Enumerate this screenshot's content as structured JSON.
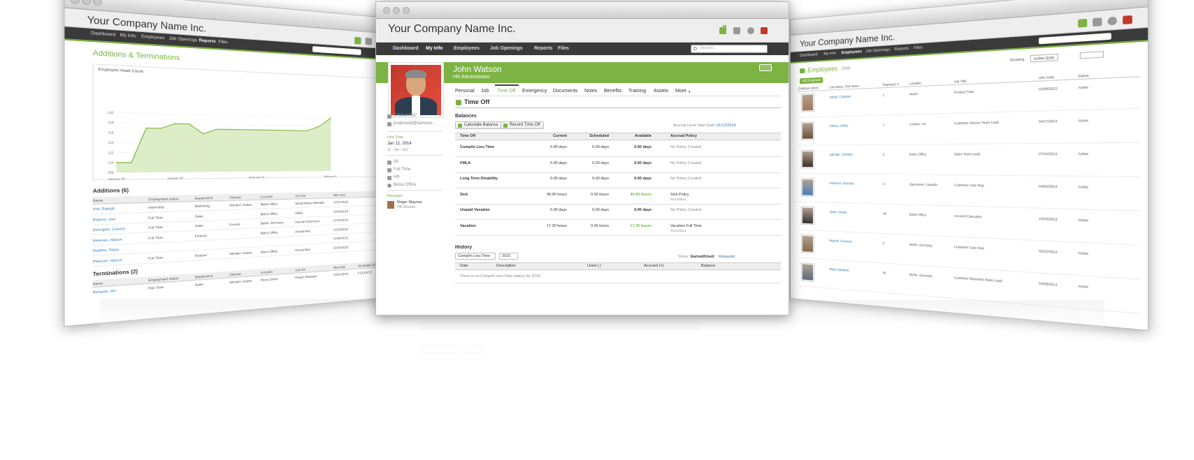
{
  "center": {
    "company": "Your Company Name Inc.",
    "search_placeholder": "Search...",
    "nav": [
      "Dashboard",
      "My Info",
      "Employees",
      "Job Openings",
      "Reports",
      "Files"
    ],
    "notify_count": "1",
    "profile": {
      "name": "John Watson",
      "title": "HR Administrator"
    },
    "tabs": [
      "Personal",
      "Job",
      "Time Off",
      "Emergency",
      "Documents",
      "Notes",
      "Benefits",
      "Training",
      "Assets",
      "More"
    ],
    "section_title": "Time Off",
    "balances_title": "Balances",
    "calc_button": "Calculate Balance",
    "record_button": "Record Time Off",
    "accrual_label": "Accrual Level Start Date:",
    "accrual_date": "01/12/2014",
    "table_headers": [
      "Time Off",
      "Current",
      "Scheduled",
      "Available",
      "Accrual Policy"
    ],
    "rows": [
      {
        "name": "Comp/In Lieu Time",
        "current": "0.00 days",
        "scheduled": "0.00 days",
        "available": "0.00 days",
        "policy": "No Policy Created",
        "policy_date": ""
      },
      {
        "name": "FMLA",
        "current": "0.00 days",
        "scheduled": "0.00 days",
        "available": "0.00 days",
        "policy": "No Policy Created",
        "policy_date": ""
      },
      {
        "name": "Long Term Disability",
        "current": "0.00 days",
        "scheduled": "0.00 days",
        "available": "0.00 days",
        "policy": "No Policy Created",
        "policy_date": ""
      },
      {
        "name": "Sick",
        "current": "40.00 hours",
        "scheduled": "0.00 hours",
        "available": "40.00 hours",
        "policy": "Sick Policy",
        "policy_date": "01/12/2014"
      },
      {
        "name": "Unpaid Vacation",
        "current": "0.00 days",
        "scheduled": "0.00 days",
        "available": "0.00 days",
        "policy": "No Policy Created",
        "policy_date": ""
      },
      {
        "name": "Vacation",
        "current": "17.20 hours",
        "scheduled": "0.00 hours",
        "available": "17.20 hours",
        "policy": "Vacation Full Time",
        "policy_date": "01/12/2014"
      }
    ],
    "history_title": "History",
    "history_type": "Comp/In Lieu Time",
    "history_year": "2015",
    "show_label": "Show:",
    "show_earned": "Earned/Used",
    "show_requests": "Requests",
    "history_headers": [
      "Date",
      "Description",
      "Used (-)",
      "Accrued (+)",
      "Balance"
    ],
    "history_empty": "There is no Comp/In Lieu Time history for 2015.",
    "sidebar": {
      "phone": "8768487687",
      "email": "pnahrwold@bamboo...",
      "hire_label": "Hire Date",
      "hire_date": "Jan 12, 2014",
      "hire_tenure": "1y - 1m - 11d",
      "emp_no": "59",
      "emp_type": "Full Time",
      "dept": "HR",
      "location": "Boise Office",
      "manager_label": "Manager",
      "manager_name": "Roger Maynes",
      "manager_title": "HR Director"
    }
  },
  "left": {
    "company": "Your Company Name Inc.",
    "nav": [
      "Dashboard",
      "My Info",
      "Employees",
      "Job Openings",
      "Reports",
      "Files"
    ],
    "page_title": "Additions & Terminations",
    "chart_title": "Employee Head Count",
    "additions_title": "Additions (6)",
    "add_headers": [
      "Name",
      "Employment status",
      "Department",
      "Division",
      "Location",
      "Job title",
      "Hire date"
    ],
    "additions": [
      {
        "name": "Holt, Raleigh",
        "status": "Internship",
        "dept": "Marketing",
        "div": "Western States",
        "loc": "Boise Office",
        "title": "Social Media Marketer",
        "date": "02/07/2015"
      },
      {
        "name": "Roberts, Joel",
        "status": "Full Time",
        "dept": "Sales",
        "div": "",
        "loc": "Boise Office",
        "title": "Seller",
        "date": "02/09/2015"
      },
      {
        "name": "DeAngelo, Lorenzo",
        "status": "Full Time",
        "dept": "Sales",
        "div": "Europe",
        "loc": "Berlin, Germany",
        "title": "Account Executive",
        "date": "02/09/2015"
      },
      {
        "name": "Petersen, Allyson",
        "status": "Full Time",
        "dept": "Finance",
        "div": "",
        "loc": "Boise Office",
        "title": "Accountant",
        "date": "02/09/2015"
      },
      {
        "name": "Hopkins, Tonya",
        "status": "",
        "dept": "",
        "div": "",
        "loc": "",
        "title": "",
        "date": "02/09/2015"
      },
      {
        "name": "Petersen, Allyson",
        "status": "Full Time",
        "dept": "Finance",
        "div": "Western States",
        "loc": "Boise Office",
        "title": "Accountant",
        "date": "02/09/2015"
      }
    ],
    "terminations_title": "Terminations (2)",
    "term_headers": [
      "Name",
      "Employment status",
      "Department",
      "Division",
      "Location",
      "Job title",
      "Hire date",
      "Termination date"
    ],
    "terminations": [
      {
        "name": "Richards, Jim",
        "status": "Part Time",
        "dept": "Sales",
        "div": "Western States",
        "loc": "Provo Office",
        "title": "Project Manager",
        "date": "03/03/2014",
        "term": "01/12/2015"
      }
    ]
  },
  "left_chart": {
    "chart_data": {
      "type": "area",
      "title": "Employee Head Count",
      "x": [
        "January 29",
        "",
        "",
        "",
        "January 30",
        "",
        "",
        "",
        "",
        "",
        "February 04",
        "",
        "",
        "",
        "",
        "",
        "February 05"
      ],
      "values": [
        110,
        110,
        117,
        117,
        118,
        118,
        116,
        117,
        117,
        117,
        117,
        117,
        117,
        117,
        117,
        118,
        120
      ],
      "ylim": [
        108,
        122
      ],
      "yticks": [
        "120",
        "118",
        "116",
        "114",
        "112",
        "110",
        "108"
      ],
      "xticklabels": [
        "January 29",
        "January 30",
        "February 04",
        "February 05"
      ],
      "color": "#7cb342"
    }
  },
  "right": {
    "company": "Your Company Name Inc.",
    "nav": [
      "Dashboard",
      "My Info",
      "Employees",
      "Job Openings",
      "Reports",
      "Files"
    ],
    "page_title": "Employees",
    "count": "(116)",
    "add_button": "Add Employee",
    "showing_label": "Showing",
    "showing_value": "Active (116)",
    "headers": [
      "Employee photo",
      "Last Name, First Name",
      "Employee #",
      "Location",
      "Job Title",
      "Hire Date",
      "Status"
    ],
    "employees": [
      {
        "name": "Abbott, Charlotte",
        "num": "1",
        "loc": "Maine",
        "title": "Product Tutor",
        "date": "02/08/2012",
        "status": "Active"
      },
      {
        "name": "Adams, Ashley",
        "num": "1",
        "loc": "London, UK",
        "title": "Customer Service Team Lead",
        "date": "04/17/2013",
        "status": "Active"
      },
      {
        "name": "Agbodjo, Christine",
        "num": "2",
        "loc": "Boise Office",
        "title": "Sales Team Lead",
        "date": "07/24/2013",
        "status": "Active"
      },
      {
        "name": "Anderson, Brandon",
        "num": "4",
        "loc": "Vancouver, Canada",
        "title": "Customer Care Rep",
        "date": "04/02/2014",
        "status": "Active"
      },
      {
        "name": "Ayala, Jordan",
        "num": "UK",
        "loc": "Boise Office",
        "title": "Account Executive",
        "date": "10/23/2013",
        "status": "Active"
      },
      {
        "name": "Bagnoli, Giovanni",
        "num": "6",
        "loc": "Berlin, Germany",
        "title": "Customer Care Rep",
        "date": "02/12/2014",
        "status": "Active"
      },
      {
        "name": "Bland, Madison",
        "num": "92",
        "loc": "Berlin, Germany",
        "title": "Customer Retention Team Lead",
        "date": "04/09/2014",
        "status": "Active"
      }
    ]
  }
}
